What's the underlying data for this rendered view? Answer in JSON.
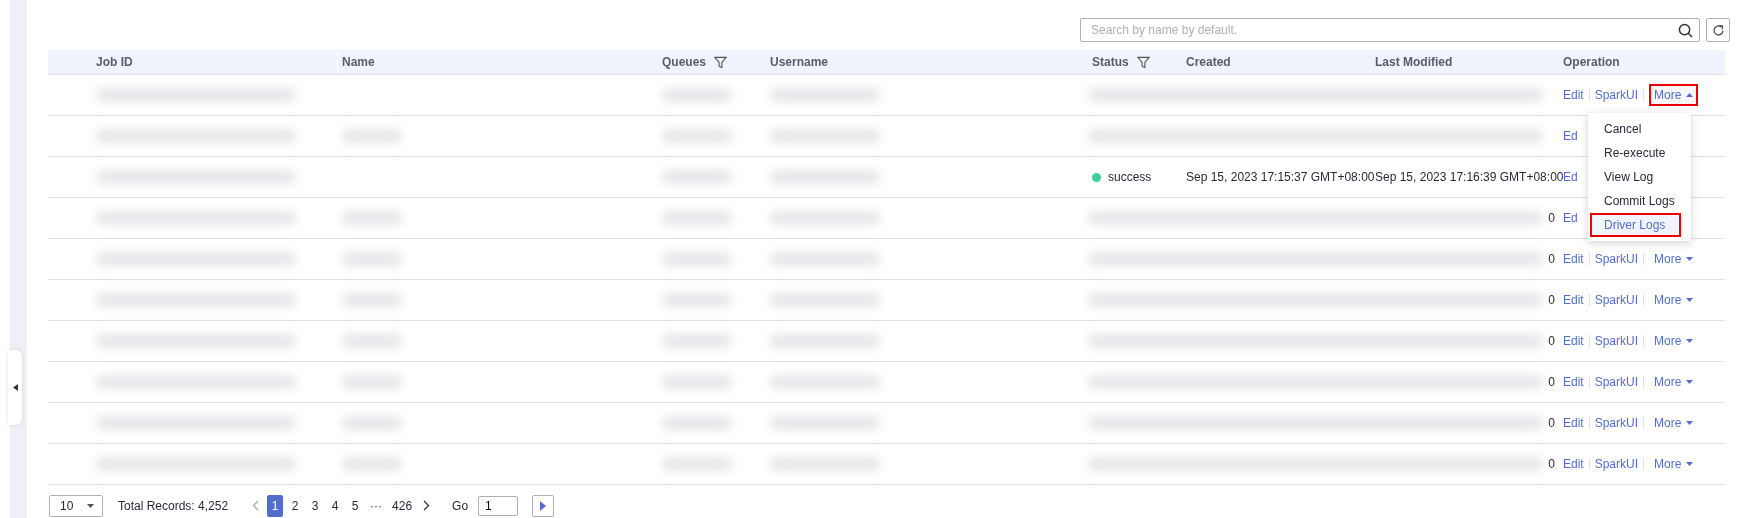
{
  "search": {
    "placeholder": "Search by name by default."
  },
  "columns": [
    {
      "label": "Job ID",
      "filter": false
    },
    {
      "label": "Name",
      "filter": false
    },
    {
      "label": "Queues",
      "filter": true
    },
    {
      "label": "Username",
      "filter": false
    },
    {
      "label": "Status",
      "filter": true
    },
    {
      "label": "Created",
      "filter": false
    },
    {
      "label": "Last Modified",
      "filter": false
    },
    {
      "label": "Operation",
      "filter": false
    }
  ],
  "rows": [
    {
      "hidden": true,
      "ops": [
        {
          "label": "Edit"
        },
        {
          "label": "SparkUI"
        },
        {
          "label": "More"
        }
      ],
      "expanded": true
    },
    {
      "hidden": true,
      "ops": [
        {
          "label": "Ed"
        }
      ]
    },
    {
      "hidden": false,
      "status": "success",
      "color": "#3ecf96",
      "created": "Sep 15, 2023 17:15:37 GMT+08:00",
      "modified": "Sep 15, 2023 17:16:39 GMT+08:00",
      "ops": [
        {
          "label": "Ed"
        }
      ]
    },
    {
      "hidden": true,
      "tail": "0",
      "ops": [
        {
          "label": "Ed"
        }
      ]
    },
    {
      "hidden": true,
      "tail": "0",
      "ops": [
        {
          "label": "Edit"
        },
        {
          "label": "SparkUI"
        },
        {
          "label": "More"
        }
      ],
      "expanded": false
    },
    {
      "hidden": true,
      "tail": "0",
      "ops": [
        {
          "label": "Edit"
        },
        {
          "label": "SparkUI"
        },
        {
          "label": "More"
        }
      ],
      "expanded": false
    },
    {
      "hidden": true,
      "tail": "0",
      "ops": [
        {
          "label": "Edit"
        },
        {
          "label": "SparkUI"
        },
        {
          "label": "More"
        }
      ],
      "expanded": false
    },
    {
      "hidden": true,
      "tail": "0",
      "ops": [
        {
          "label": "Edit"
        },
        {
          "label": "SparkUI"
        },
        {
          "label": "More"
        }
      ],
      "expanded": false
    },
    {
      "hidden": true,
      "tail": "0",
      "ops": [
        {
          "label": "Edit"
        },
        {
          "label": "SparkUI"
        },
        {
          "label": "More"
        }
      ],
      "expanded": false
    },
    {
      "hidden": true,
      "tail": "0",
      "ops": [
        {
          "label": "Edit"
        },
        {
          "label": "SparkUI"
        },
        {
          "label": "More"
        }
      ],
      "expanded": false
    }
  ],
  "menu": [
    {
      "label": "Cancel",
      "selected": false
    },
    {
      "label": "Re-execute",
      "selected": false
    },
    {
      "label": "View Log",
      "selected": false
    },
    {
      "label": "Commit Logs",
      "selected": false
    },
    {
      "label": "Driver Logs",
      "selected": true
    }
  ],
  "pagination": {
    "page_size": "10",
    "total": "Total Records: 4,252",
    "pages": [
      {
        "label": "1",
        "selected": true
      },
      {
        "label": "2",
        "selected": false
      },
      {
        "label": "3",
        "selected": false
      },
      {
        "label": "4",
        "selected": false
      },
      {
        "label": "5",
        "selected": false
      },
      {
        "label": "···",
        "selected": false
      },
      {
        "label": "426",
        "selected": false
      }
    ],
    "go_label": "Go",
    "go_value": "1"
  }
}
